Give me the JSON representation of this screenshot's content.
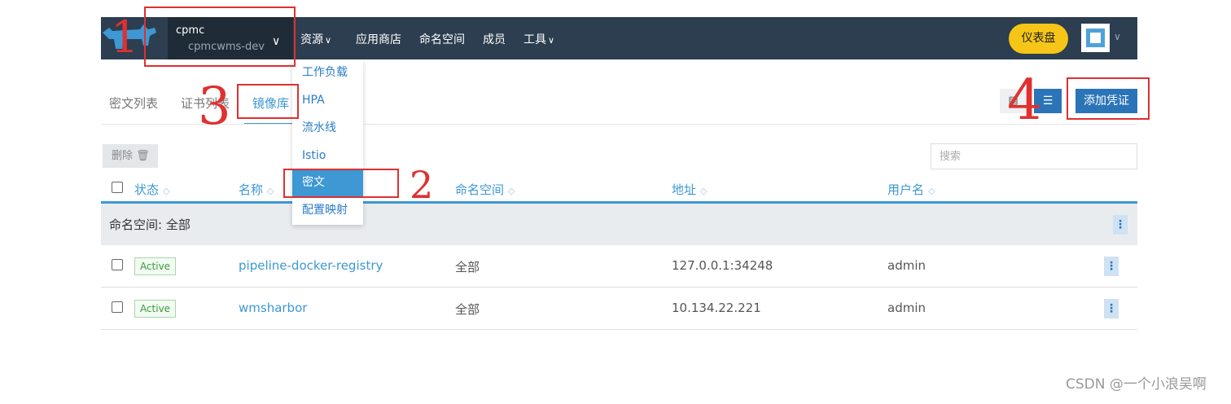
{
  "header": {
    "cluster_name": "cpmc",
    "project_name": "cpmcwms-dev",
    "nav": [
      "资源",
      "应用商店",
      "命名空间",
      "成员",
      "工具"
    ],
    "dashboard_label": "仪表盘"
  },
  "resource_menu": {
    "items": [
      "工作负载",
      "HPA",
      "流水线",
      "Istio",
      "密文",
      "配置映射"
    ]
  },
  "tabs": [
    "密文列表",
    "证书列表",
    "镜像库"
  ],
  "toolbar": {
    "add_label": "添加凭证",
    "delete_label": "删除",
    "search_placeholder": "搜索"
  },
  "table": {
    "columns": [
      "状态",
      "名称",
      "命名空间",
      "地址",
      "用户名"
    ],
    "group_label": "命名空间: 全部",
    "rows": [
      {
        "status": "Active",
        "name": "pipeline-docker-registry",
        "namespace": "全部",
        "address": "127.0.0.1:34248",
        "username": "admin"
      },
      {
        "status": "Active",
        "name": "wmsharbor",
        "namespace": "全部",
        "address": "10.134.22.221",
        "username": "admin"
      }
    ]
  },
  "annotations": [
    "1",
    "2",
    "3",
    "4"
  ],
  "watermark": "CSDN @一个小浪吴啊",
  "colors": {
    "topbar": "#2c3e50",
    "accent": "#3d98d3",
    "primary_button": "#2b74b8",
    "dashboard_button": "#f5c518",
    "annotation": "#e03030",
    "active_badge": "#3c9a3c"
  }
}
